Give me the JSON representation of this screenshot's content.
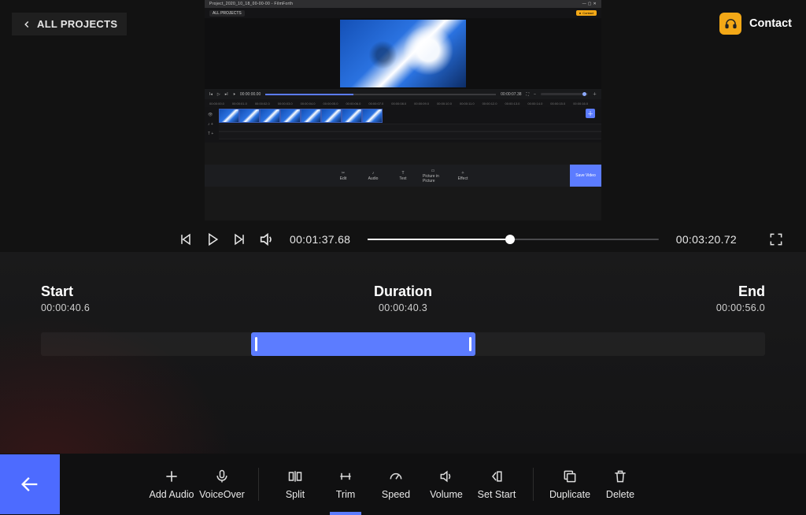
{
  "header": {
    "all_projects_label": "ALL PROJECTS",
    "contact_label": "Contact"
  },
  "subwindow": {
    "title": "Project_2020_10_18_00-00-00 - FilmForth",
    "all_projects": "ALL PROJECTS",
    "contact": "Contact",
    "current_time": "00:00:00.00",
    "total_time": "00:00:07.38",
    "ruler": [
      "00:00:00.0",
      "00:00:01.0",
      "00:00:02.0",
      "00:00:03.0",
      "00:00:04.0",
      "00:00:05.0",
      "00:00:06.0",
      "00:00:07.0",
      "00:00:08.0",
      "00:00:09.0",
      "00:00:10.0",
      "00:00:11.0",
      "00:00:12.0",
      "00:00:13.0",
      "00:00:14.0",
      "00:00:15.0",
      "00:00:16.0"
    ],
    "toolbar": {
      "edit": "Edit",
      "audio": "Audio",
      "text": "Text",
      "pip": "Picture in Picture",
      "effect": "Effect",
      "save": "Save Video"
    }
  },
  "playback": {
    "current": "00:01:37.68",
    "total": "00:03:20.72",
    "progress_pct": 49
  },
  "trim": {
    "start_label": "Start",
    "start_tc": "00:00:40.6",
    "duration_label": "Duration",
    "duration_tc": "00:00:40.3",
    "end_label": "End",
    "end_tc": "00:00:56.0"
  },
  "bottom": {
    "add_audio": "Add Audio",
    "voiceover": "VoiceOver",
    "split": "Split",
    "trim": "Trim",
    "speed": "Speed",
    "volume": "Volume",
    "set_start": "Set Start",
    "duplicate": "Duplicate",
    "delete": "Delete"
  }
}
